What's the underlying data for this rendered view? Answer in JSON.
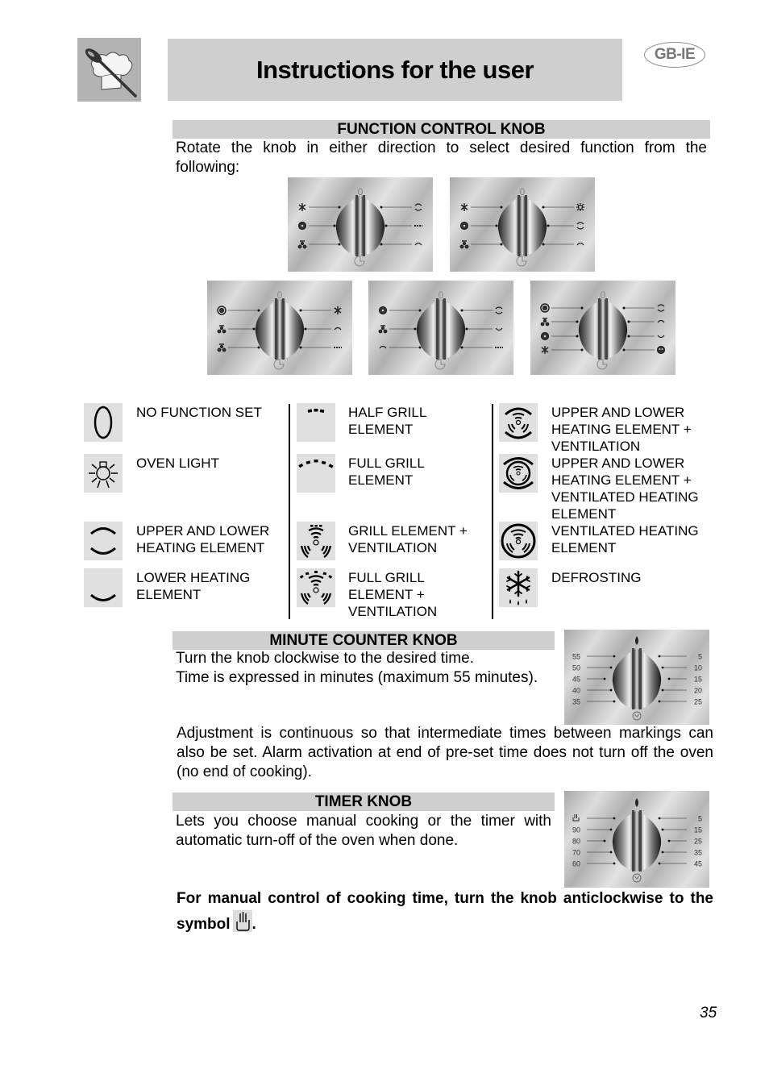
{
  "header": {
    "title": "Instructions for the user",
    "region_badge": "GB-IE",
    "logo_icon": "chef-hat-spoon-icon"
  },
  "function_knob": {
    "heading": "FUNCTION CONTROL KNOB",
    "description": "Rotate the knob in either direction to select desired function from the following:",
    "panels": [
      {
        "top_symbol": "0",
        "left": [
          "defrost",
          "fan-grill",
          "grill-fan"
        ],
        "right": [
          "upper-lower",
          "half-grill",
          "upper"
        ]
      },
      {
        "top_symbol": "0",
        "left": [
          "defrost",
          "fan-grill",
          "grill-fan"
        ],
        "right": [
          "light",
          "upper-lower",
          "upper"
        ]
      },
      {
        "top_symbol": "0",
        "left": [
          "fan-ring",
          "grill-fan",
          "full-grill-fan"
        ],
        "right": [
          "defrost",
          "upper",
          "half-grill"
        ]
      },
      {
        "top_symbol": "0",
        "left": [
          "fan-grill",
          "grill-fan",
          "upper"
        ],
        "right": [
          "upper-lower",
          "lower",
          "half-grill"
        ]
      },
      {
        "top_symbol": "0",
        "left": [
          "fan-ring",
          "grill-fan",
          "fan-grill",
          "defrost"
        ],
        "right": [
          "upper-lower",
          "upper",
          "lower",
          "fan-circle"
        ]
      }
    ]
  },
  "legend": {
    "columns": [
      [
        {
          "icon": "no-function-icon",
          "label": "NO FUNCTION SET"
        },
        {
          "icon": "oven-light-icon",
          "label": "OVEN LIGHT"
        },
        {
          "icon": "upper-lower-heating-icon",
          "label": "UPPER AND LOWER HEATING ELEMENT"
        },
        {
          "icon": "lower-heating-icon",
          "label": "LOWER HEATING ELEMENT"
        }
      ],
      [
        {
          "icon": "half-grill-icon",
          "label": "HALF GRILL ELEMENT"
        },
        {
          "icon": "full-grill-icon",
          "label": "FULL GRILL ELEMENT"
        },
        {
          "icon": "grill-ventilation-icon",
          "label": "GRILL ELEMENT + VENTILATION"
        },
        {
          "icon": "full-grill-ventilation-icon",
          "label": "FULL GRILL ELEMENT + VENTILATION"
        }
      ],
      [
        {
          "icon": "upper-lower-ventilation-icon",
          "label": "UPPER AND LOWER HEATING ELEMENT + VENTILATION"
        },
        {
          "icon": "upper-lower-ventilated-heating-icon",
          "label": "UPPER AND LOWER HEATING ELEMENT + VENTILATED HEATING ELEMENT"
        },
        {
          "icon": "ventilated-heating-icon",
          "label": "VENTILATED HEATING ELEMENT"
        },
        {
          "icon": "defrosting-icon",
          "label": "DEFROSTING"
        }
      ]
    ]
  },
  "minute_counter": {
    "heading": "MINUTE COUNTER KNOB",
    "line1": "Turn the knob clockwise to the desired time.",
    "line2": "Time is expressed in minutes (maximum 55 minutes).",
    "note": "Adjustment is continuous so that intermediate times between markings can also be set. Alarm activation at end of pre-set time does not turn off the oven (no end of cooking).",
    "dial_left": [
      "55",
      "50",
      "45",
      "40",
      "35"
    ],
    "dial_right": [
      "5",
      "10",
      "15",
      "20",
      "25"
    ]
  },
  "timer": {
    "heading": "TIMER KNOB",
    "description": "Lets you choose manual cooking or the timer with automatic turn-off of the oven when done.",
    "dial_left": [
      "hand",
      "90",
      "80",
      "70",
      "60"
    ],
    "dial_right": [
      "5",
      "15",
      "25",
      "35",
      "45"
    ],
    "manual_note": "For manual control of cooking time, turn the knob anticlockwise to the symbol",
    "manual_note_end": "."
  },
  "footer": {
    "page_number": "35"
  }
}
